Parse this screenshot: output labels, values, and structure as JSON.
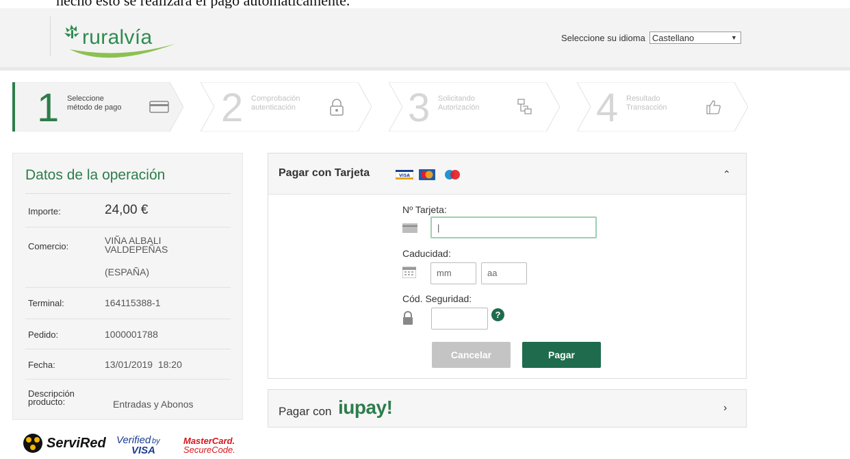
{
  "document_text": "hecho esto se realizará el pago automáticamente.",
  "brand": {
    "name": "ruralvía",
    "color": "#2e8b4e"
  },
  "language": {
    "label": "Seleccione su idioma",
    "selected": "Castellano"
  },
  "steps": [
    {
      "number": "1",
      "line1": "Seleccione",
      "line2": "método de pago",
      "icon": "credit-card-icon",
      "active": true
    },
    {
      "number": "2",
      "line1": "Comprobación",
      "line2": "autenticación",
      "icon": "padlock-icon",
      "active": false
    },
    {
      "number": "3",
      "line1": "Solicitando",
      "line2": "Autorización",
      "icon": "network-icon",
      "active": false
    },
    {
      "number": "4",
      "line1": "Resultado",
      "line2": "Transacción",
      "icon": "thumbs-up-icon",
      "active": false
    }
  ],
  "operation": {
    "title": "Datos de la operación",
    "importe_label": "Importe:",
    "importe_value": "24,00 €",
    "comercio_label": "Comercio:",
    "comercio_line1": "VIÑA ALBALI",
    "comercio_line2": "VALDEPEÑAS",
    "comercio_line3": "(ESPAÑA)",
    "terminal_label": "Terminal:",
    "terminal_value": "164115388-1",
    "pedido_label": "Pedido:",
    "pedido_value": "1000001788",
    "fecha_label": "Fecha:",
    "fecha_value": "13/01/2019  18:20",
    "descripcion_label1": "Descripción",
    "descripcion_label2": "producto:",
    "descripcion_value": "Entradas y Abonos"
  },
  "card_payment": {
    "title": "Pagar con Tarjeta",
    "card_number_label": "Nº Tarjeta:",
    "card_number_value": "|",
    "expiry_label": "Caducidad:",
    "month_placeholder": "mm",
    "year_placeholder": "aa",
    "cvv_label": "Cód. Seguridad:",
    "help_symbol": "?",
    "cancel_label": "Cancelar",
    "pay_label": "Pagar",
    "visa_text": "VISA"
  },
  "iupay": {
    "prefix": "Pagar con",
    "brand": "iupay!"
  },
  "footer_logos": {
    "servired": "ServiRed",
    "verified_line1": "Verified",
    "verified_by": "by",
    "verified_line2": "VISA",
    "mc_line1": "MasterCard.",
    "mc_line2": "SecureCode."
  },
  "colors": {
    "accent": "#2d7d4b",
    "pay_button": "#1f6b4d",
    "cancel_button": "#c4c4c4",
    "focus_border": "#9ccfb1"
  }
}
